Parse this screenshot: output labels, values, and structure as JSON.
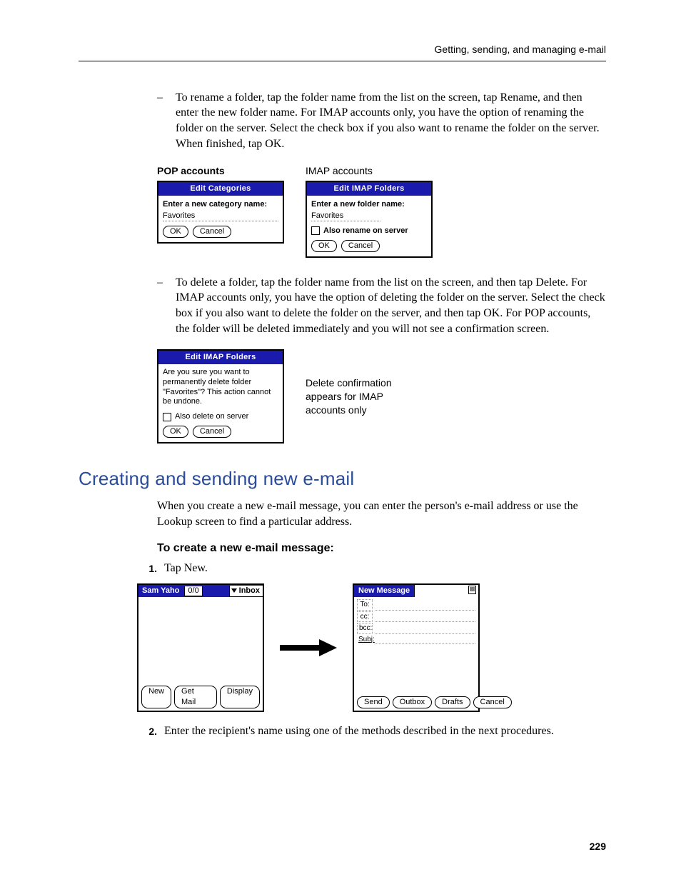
{
  "runningHead": "Getting, sending, and managing e-mail",
  "para_rename": "To rename a folder, tap the folder name from the list on the screen, tap Rename, and then enter the new folder name. For IMAP accounts only, you have the option of renaming the folder on the server. Select the check box if you also want to rename the folder on the server. When finished, tap OK.",
  "captions": {
    "pop": "POP accounts",
    "imap": "IMAP accounts"
  },
  "dlg_pop": {
    "title": "Edit Categories",
    "prompt": "Enter a new category name:",
    "value": "Favorites",
    "ok": "OK",
    "cancel": "Cancel"
  },
  "dlg_imap": {
    "title": "Edit IMAP Folders",
    "prompt": "Enter a new folder name:",
    "value": "Favorites",
    "checkbox": "Also rename on server",
    "ok": "OK",
    "cancel": "Cancel"
  },
  "para_delete": "To delete a folder, tap the folder name from the list on the screen, and then tap Delete. For IMAP accounts only, you have the option of deleting the folder on the server. Select the check box if you also want to delete the folder on the server, and then tap OK. For POP accounts, the folder will be deleted immediately and you will not see a confirmation screen.",
  "dlg_delete": {
    "title": "Edit IMAP Folders",
    "text": "Are you sure you want to permanently delete folder \"Favorites\"? This action cannot be undone.",
    "checkbox": "Also delete on server",
    "ok": "OK",
    "cancel": "Cancel"
  },
  "delete_note": "Delete confirmation appears for IMAP accounts only",
  "h2": "Creating and sending new e-mail",
  "para_intro": "When you create a new e-mail message, you can enter the person's e-mail address or use the Lookup screen to find a particular address.",
  "subhead": "To create a new e-mail message:",
  "step1_num": "1.",
  "step1": "Tap New.",
  "inbox": {
    "account": "Sam Yaho",
    "count": "0/0",
    "folder": "Inbox",
    "btn_new": "New",
    "btn_get": "Get Mail",
    "btn_display": "Display"
  },
  "newmsg": {
    "title": "New Message",
    "to": "To:",
    "cc": "cc:",
    "bcc": "bcc:",
    "subj": "Subj:",
    "btn_send": "Send",
    "btn_outbox": "Outbox",
    "btn_drafts": "Drafts",
    "btn_cancel": "Cancel"
  },
  "step2_num": "2.",
  "step2": "Enter the recipient's name using one of the methods described in the next procedures.",
  "pageNumber": "229"
}
